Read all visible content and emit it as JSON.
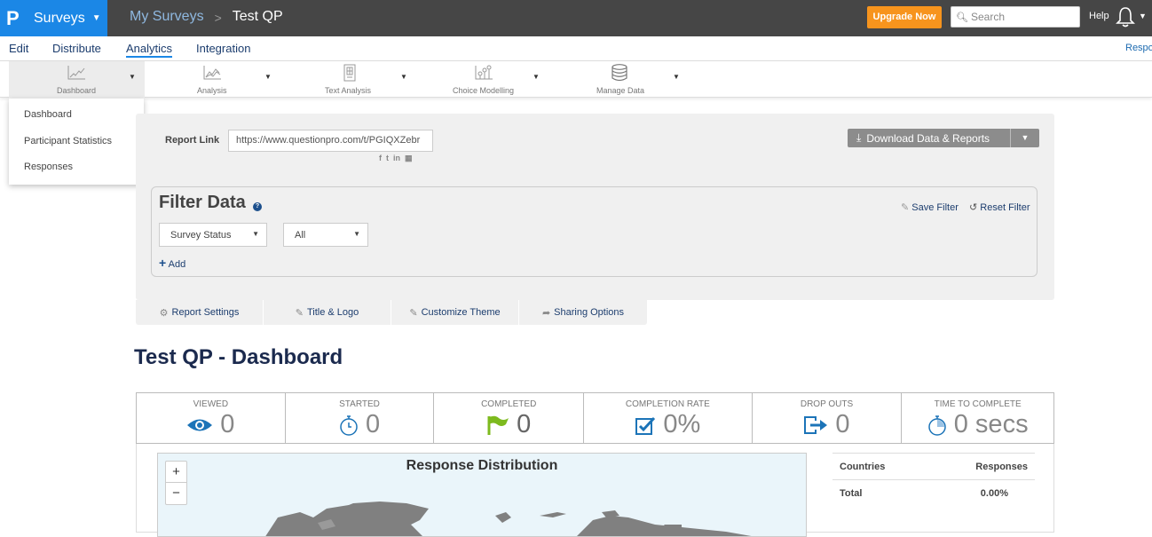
{
  "topbar": {
    "logo": "P",
    "app_name": "Surveys",
    "breadcrumb": {
      "parent": "My Surveys",
      "separator": ">",
      "current": "Test QP"
    },
    "upgrade_label": "Upgrade Now",
    "search_placeholder": "Search",
    "help_label": "Help",
    "colors": {
      "brand": "#1b87e6",
      "bar": "#464646",
      "upgrade": "#f7941d"
    }
  },
  "tabs": [
    {
      "label": "Edit",
      "active": false
    },
    {
      "label": "Distribute",
      "active": false
    },
    {
      "label": "Analytics",
      "active": true
    },
    {
      "label": "Integration",
      "active": false
    }
  ],
  "tabs_right_label": "Respo",
  "toolbar": [
    {
      "label": "Dashboard",
      "icon": "line-chart-icon",
      "active": true
    },
    {
      "label": "Analysis",
      "icon": "area-chart-icon",
      "active": false
    },
    {
      "label": "Text Analysis",
      "icon": "document-grid-icon",
      "active": false
    },
    {
      "label": "Choice Modelling",
      "icon": "scatter-chart-icon",
      "active": false
    },
    {
      "label": "Manage Data",
      "icon": "database-icon",
      "active": false
    }
  ],
  "dashboard_menu": [
    "Dashboard",
    "Participant Statistics",
    "Responses"
  ],
  "report": {
    "link_label": "Report Link",
    "link_value": "https://www.questionpro.com/t/PGIQXZebr",
    "social": [
      "facebook-icon",
      "twitter-icon",
      "linkedin-icon",
      "qr-code-icon"
    ],
    "download_label": "Download Data & Reports"
  },
  "filter": {
    "title": "Filter Data",
    "help": "?",
    "save_label": "Save Filter",
    "reset_label": "Reset Filter",
    "field_select": "Survey Status",
    "value_select": "All",
    "add_label": "Add"
  },
  "report_tabs": [
    {
      "label": "Report Settings",
      "icon": "gears-icon"
    },
    {
      "label": "Title & Logo",
      "icon": "edit-icon"
    },
    {
      "label": "Customize Theme",
      "icon": "edit-icon"
    },
    {
      "label": "Sharing Options",
      "icon": "share-icon"
    }
  ],
  "page_title": "Test QP - Dashboard",
  "stats": [
    {
      "label": "VIEWED",
      "value": "0",
      "icon": "eye-icon"
    },
    {
      "label": "STARTED",
      "value": "0",
      "icon": "stopwatch-icon"
    },
    {
      "label": "COMPLETED",
      "value": "0",
      "icon": "flag-icon"
    },
    {
      "label": "COMPLETION RATE",
      "value": "0%",
      "icon": "checkbox-icon"
    },
    {
      "label": "DROP OUTS",
      "value": "0",
      "icon": "exit-icon"
    },
    {
      "label": "TIME TO COMPLETE",
      "value": "0 secs",
      "icon": "stopwatch-icon"
    }
  ],
  "map": {
    "title": "Response Distribution",
    "zoom_in": "+",
    "zoom_out": "−"
  },
  "countries_table": {
    "headers": [
      "Countries",
      "Responses"
    ],
    "rows": [
      [
        "Total",
        "0.00%"
      ]
    ]
  }
}
